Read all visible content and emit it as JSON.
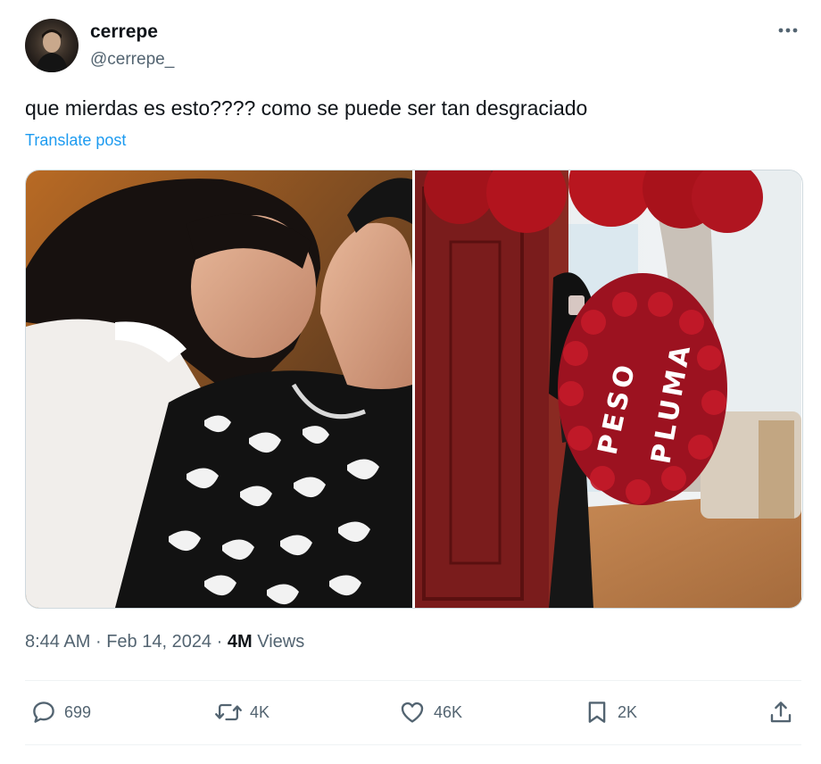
{
  "author": {
    "display_name": "cerrepe",
    "handle": "@cerrepe_",
    "avatar_icon": "profile-photo"
  },
  "tweet": {
    "text": "que mierdas es esto???? como se puede ser tan desgraciado",
    "translate_label": "Translate post"
  },
  "media": {
    "photos": [
      {
        "icon": "photo-couple-selfie"
      },
      {
        "icon": "photo-rose-bouquet",
        "bouquet_letters": [
          "PESO",
          "PLUMA"
        ]
      }
    ]
  },
  "meta": {
    "time": "8:44 AM",
    "separator": "·",
    "date": "Feb 14, 2024",
    "views_count": "4M",
    "views_label": "Views"
  },
  "actions": {
    "reply_count": "699",
    "repost_count": "4K",
    "like_count": "46K",
    "bookmark_count": "2K"
  },
  "colors": {
    "link": "#1d9bf0",
    "secondary_text": "#536471",
    "primary_text": "#0f1419",
    "divider": "#eff3f4"
  }
}
